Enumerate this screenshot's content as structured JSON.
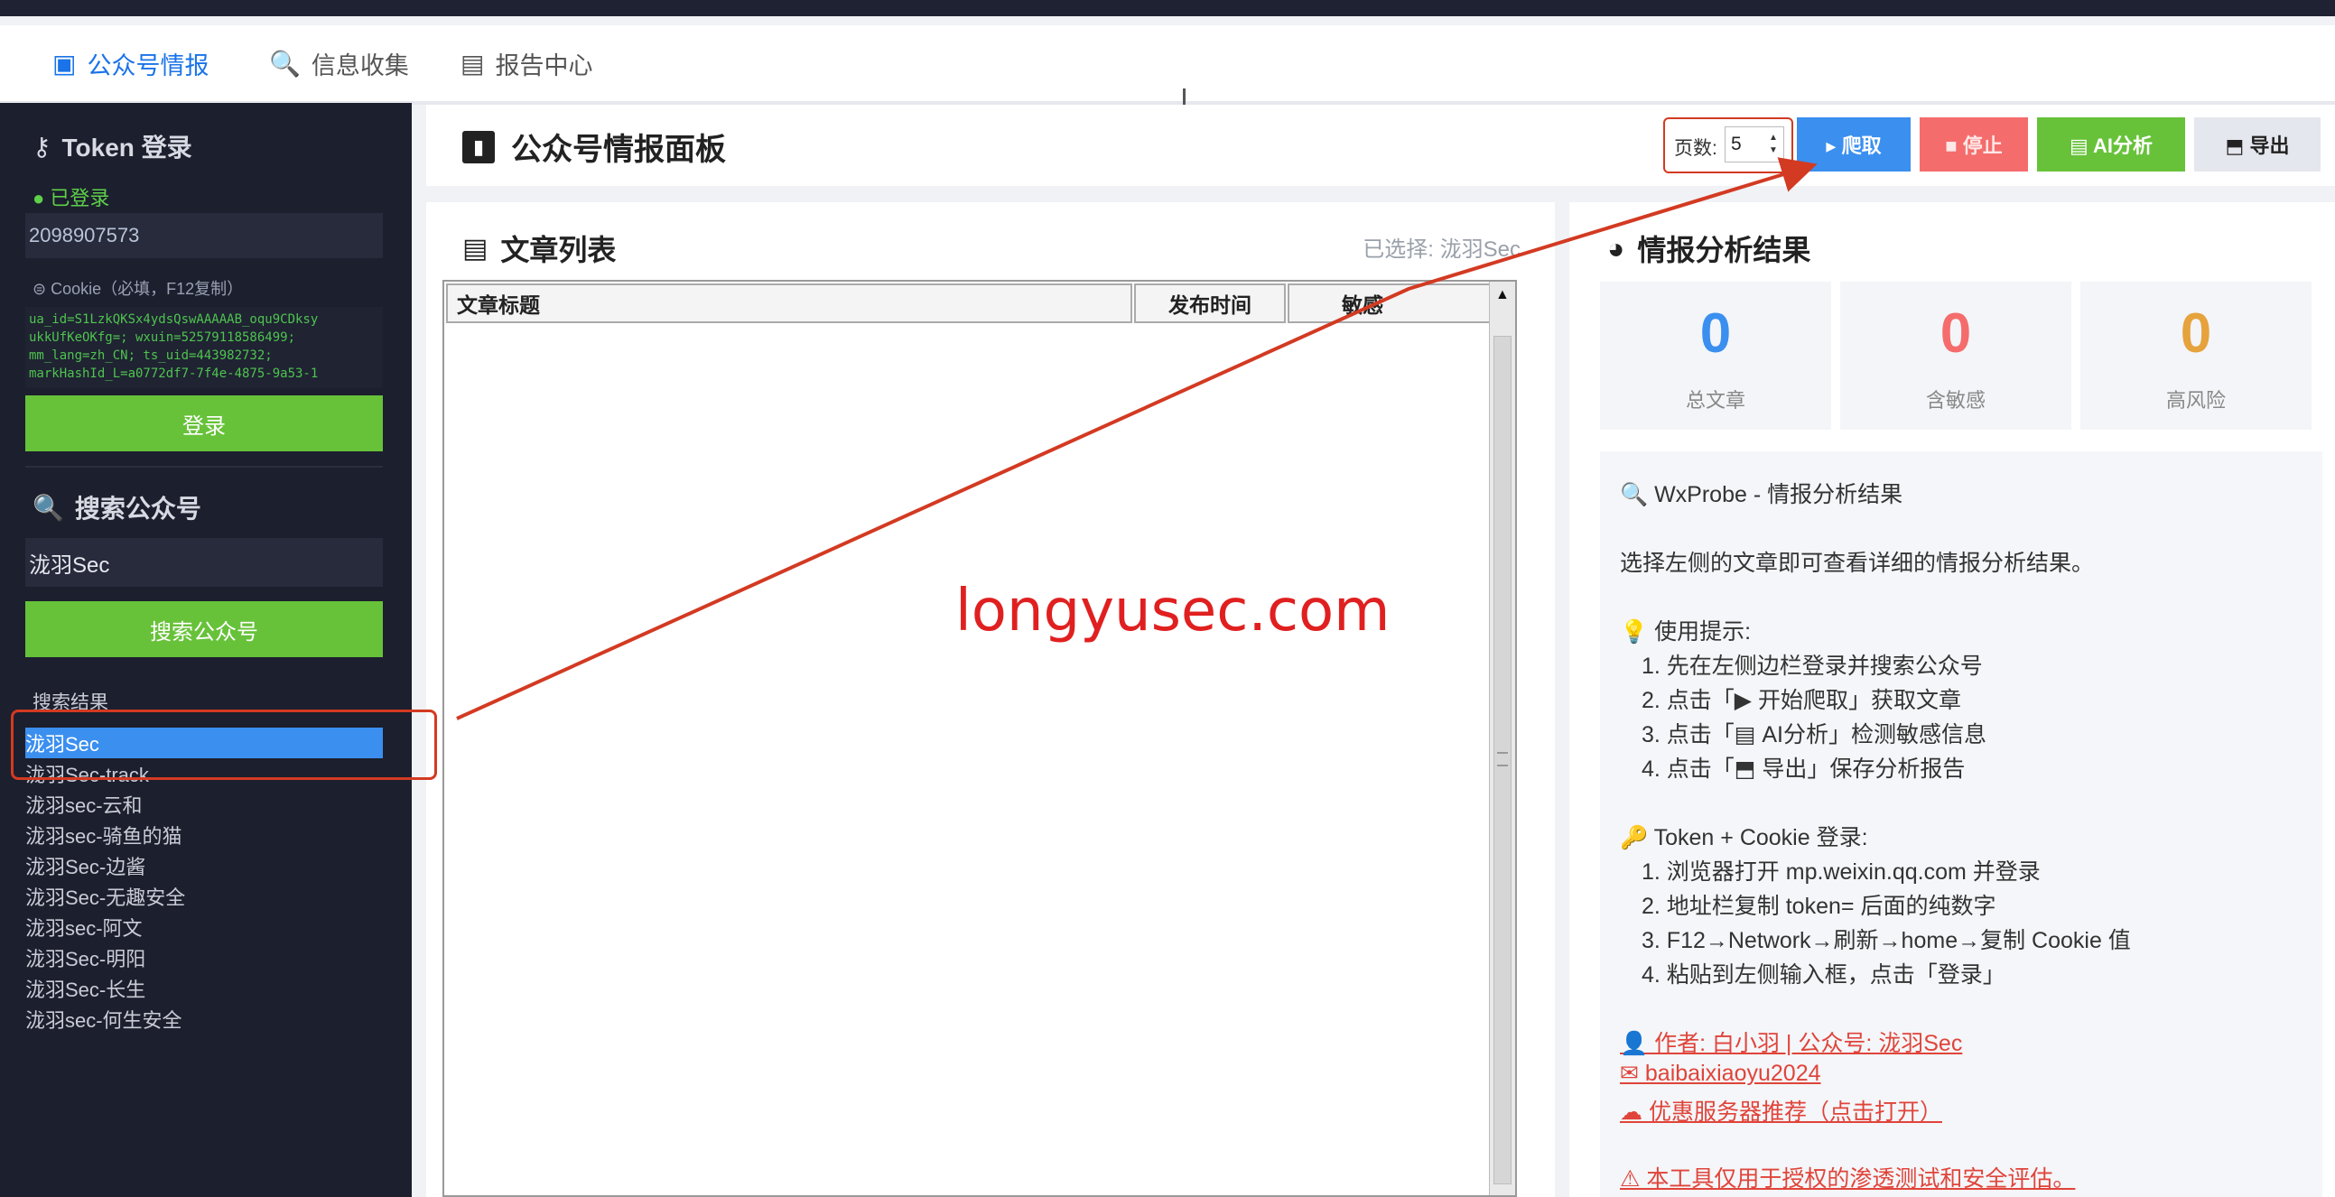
{
  "tabs": [
    {
      "icon": "id-card-icon",
      "glyph": "▣",
      "label": "公众号情报",
      "active": true
    },
    {
      "icon": "magnifier-icon",
      "glyph": "🔍",
      "label": "信息收集",
      "active": false
    },
    {
      "icon": "clipboard-icon",
      "glyph": "▤",
      "label": "报告中心",
      "active": false
    }
  ],
  "sidebar": {
    "token_header": "Token 登录",
    "status": "● 已登录",
    "token_value": "2098907573",
    "cookie_label": "Cookie（必填，F12复制）",
    "cookie_value": "ua_id=S1LzkQKSx4ydsQswAAAAAB_oqu9CDksy\nukkUfKeOKfg=; wxuin=52579118586499;\nmm_lang=zh_CN; ts_uid=443982732;\nmarkHashId_L=a0772df7-7f4e-4875-9a53-1",
    "login_button": "登录",
    "search_header": "搜索公众号",
    "search_value": "泷羽Sec",
    "search_button": "搜索公众号",
    "results_label": "搜索结果",
    "results": [
      "泷羽Sec",
      "泷羽Sec-track",
      "泷羽sec-云和",
      "泷羽sec-骑鱼的猫",
      "泷羽Sec-边酱",
      "泷羽Sec-无趣安全",
      "泷羽sec-阿文",
      "泷羽Sec-明阳",
      "泷羽Sec-长生",
      "泷羽sec-何生安全"
    ],
    "selected_index": 0
  },
  "header": {
    "title": "公众号情报面板",
    "pages_label": "页数:",
    "pages_value": "5",
    "buttons": {
      "crawl": "▸ 爬取",
      "stop": "■ 停止",
      "ai": "▤ AI分析",
      "export": "⬒ 导出"
    }
  },
  "article_list": {
    "title": "文章列表",
    "selected": "已选择: 泷羽Sec",
    "columns": [
      "文章标题",
      "发布时间",
      "敏感"
    ]
  },
  "analysis": {
    "title": "情报分析结果",
    "stats": [
      {
        "value": "0",
        "label": "总文章",
        "color": "#3b8fef"
      },
      {
        "value": "0",
        "label": "含敏感",
        "color": "#f56c6c"
      },
      {
        "value": "0",
        "label": "高风险",
        "color": "#e6a23c"
      }
    ],
    "lines": [
      "🔍  WxProbe - 情报分析结果",
      "选择左侧的文章即可查看详细的情报分析结果。",
      "💡  使用提示:",
      "1. 先在左侧边栏登录并搜索公众号",
      "2. 点击「▶ 开始爬取」获取文章",
      "3. 点击「▤ AI分析」检测敏感信息",
      "4. 点击「⬒ 导出」保存分析报告",
      "🔑  Token + Cookie 登录:",
      "1. 浏览器打开 mp.weixin.qq.com 并登录",
      "2. 地址栏复制 token= 后面的纯数字",
      "3. F12→Network→刷新→home→复制 Cookie 值",
      "4. 粘贴到左侧输入框，点击「登录」"
    ],
    "links": [
      "👤 作者: 白小羽 | 公众号: 泷羽Sec",
      "✉ baibaixiaoyu2024",
      "☁ 优惠服务器推荐（点击打开）"
    ],
    "warning": "⚠ 本工具仅用于授权的渗透测试和安全评估。"
  },
  "watermark": "longyusec.com",
  "colors": {
    "primary": "#3b8fef",
    "success": "#67c23a",
    "danger": "#f56c6c",
    "warning": "#e6a23c",
    "sidebar": "#1c1f2d",
    "annotation": "#d33a22"
  }
}
